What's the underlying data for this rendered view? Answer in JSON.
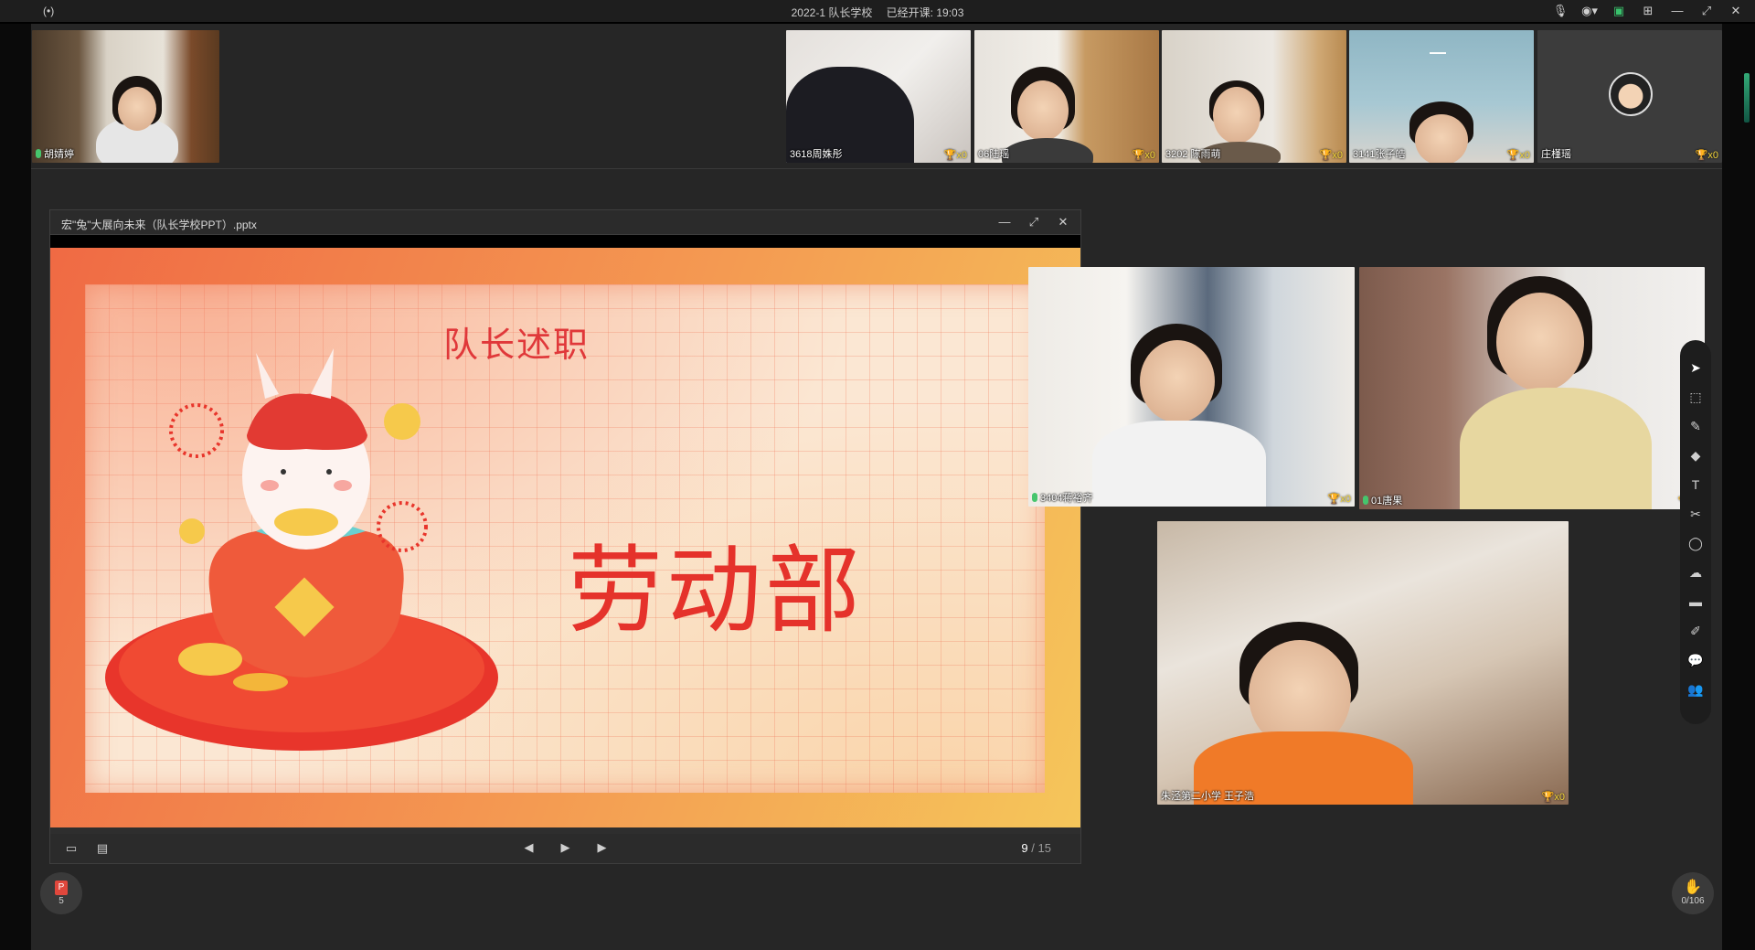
{
  "window": {
    "title": "2022-1 队长学校",
    "elapsed_label": "已经开课: 19:03"
  },
  "top_row": [
    {
      "name": "胡婧婷",
      "trophy": ""
    },
    {
      "name": "3618周姝彤",
      "trophy": "x0"
    },
    {
      "name": "06陆瑶",
      "trophy": "x0"
    },
    {
      "name": "3202 陈雨萌",
      "trophy": "x0"
    },
    {
      "name": "3141张子皓",
      "trophy": "x0"
    },
    {
      "name": "庄槿瑶",
      "trophy": "x0"
    }
  ],
  "ppt": {
    "filename": "宏\"兔\"大展向未来（队长学校PPT）.pptx",
    "slide": {
      "subtitle": "队长述职",
      "main_title": "劳动部"
    },
    "page_current": "9",
    "page_sep": "/",
    "page_total": "15"
  },
  "videos": [
    {
      "name": "3404蒋裕齐",
      "trophy": "x0"
    },
    {
      "name": "01唐果",
      "trophy": "x0"
    },
    {
      "name": "朱泾第二小学 王子浩",
      "trophy": "x0"
    }
  ],
  "badges": {
    "ppt_count": "5",
    "ppt_icon": "P",
    "hands_count": "0/106"
  },
  "icons": {
    "signal": "signal-icon",
    "mic": "microphone-icon",
    "camera": "camera-icon",
    "record": "record-icon",
    "grid": "grid-icon",
    "minimize": "minimize-icon",
    "restore": "restore-icon",
    "close": "close-icon"
  },
  "colors": {
    "accent_green": "#39c26c",
    "slide_title_red": "#e5322b",
    "trophy_gold": "#f1d43a"
  }
}
